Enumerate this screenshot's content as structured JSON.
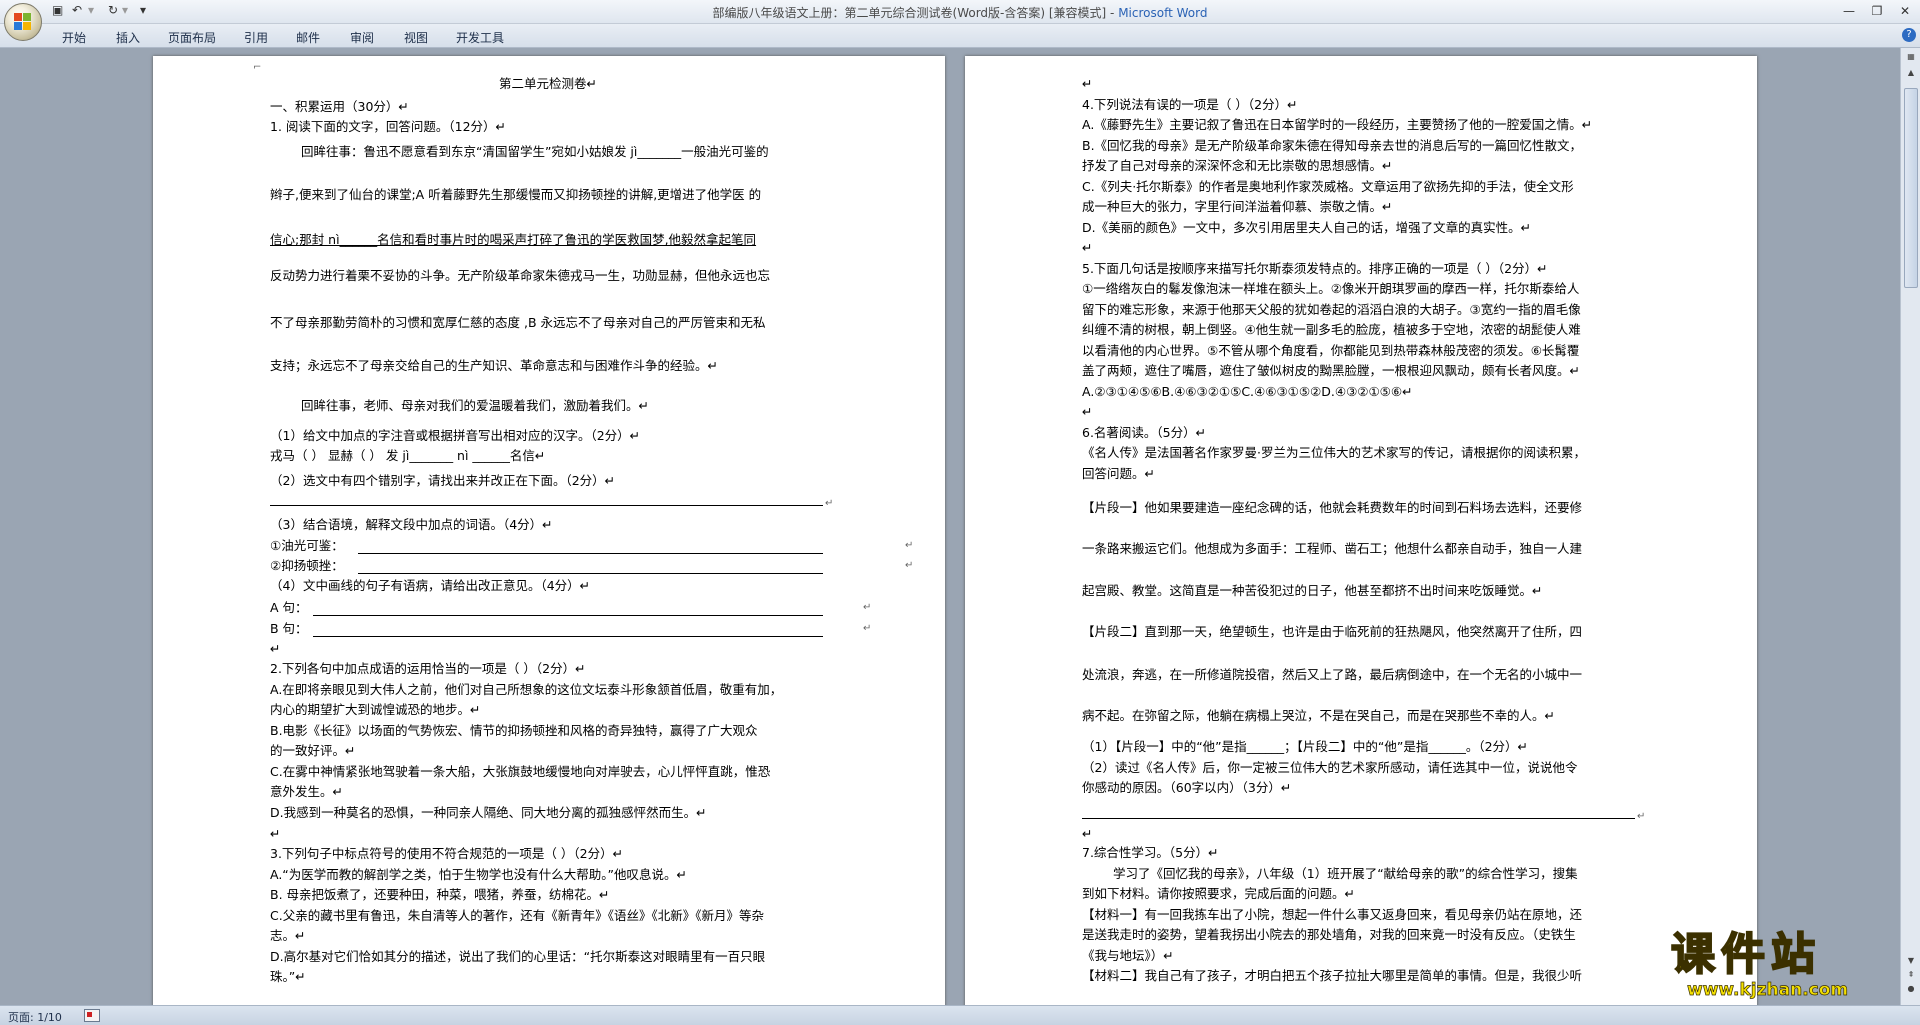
{
  "window": {
    "title": "部编版八年级语文上册：第二单元综合测试卷(Word版-含答案) [兼容模式] - ",
    "app_name": "Microsoft Word",
    "controls": [
      "—",
      "❐",
      "✕"
    ]
  },
  "qat": {
    "save_icon": "save-icon",
    "undo": "↶",
    "redo": "↻",
    "more": "▾"
  },
  "ribbon": {
    "tabs": [
      "开始",
      "插入",
      "页面布局",
      "引用",
      "邮件",
      "审阅",
      "视图",
      "开发工具"
    ],
    "help": "?"
  },
  "status": {
    "page_indicator": "页面: 1/10"
  },
  "page1": [
    {
      "t": "第二单元检测卷↵"
    },
    {
      "t": "一、积累运用（30分）↵"
    },
    {
      "t": "1. 阅读下面的文字，回答问题。（12分）↵"
    },
    {
      "t": "回眸往事：鲁迅不愿意看到东京“清国留学生”宛如小姑娘发 jì_______一般油光可鉴的"
    },
    {
      "t": "辫子,便来到了仙台的课堂;A 听着藤野先生那缓慢而又抑扬顿挫的讲解,更增进了他学医 的"
    },
    {
      "t": "信心;那封 nì______名信和看时事片时的喝采声打碎了鲁迅的学医救国梦,他毅然拿起笔同"
    },
    {
      "t": "反动势力进行着栗不妥协的斗争。无产阶级革命家朱德戎马一生，功勋显赫，但他永远也忘"
    },
    {
      "t": "不了母亲那勤劳简朴的习惯和宽厚仁慈的态度 ,B 永远忘不了母亲对自己的严厉管束和无私"
    },
    {
      "t": "支持；永远忘不了母亲交给自己的生产知识、革命意志和与困难作斗争的经验。↵"
    },
    {
      "t": "回眸往事，老师、母亲对我们的爱温暖着我们，激励着我们。↵"
    },
    {
      "t": "（1）给文中加点的字注音或根据拼音写出相对应的汉字。（2分）↵"
    },
    {
      "t": "戎马（     ）    显赫（     ）    发 jì_______     nì ______名信↵"
    },
    {
      "t": "（2）选文中有四个错别字，请找出来并改正在下面。（2分）↵"
    },
    {
      "t": "（3）结合语境，解释文段中加点的词语。（4分）↵"
    },
    {
      "t": "①油光可鉴："
    },
    {
      "t": "②抑扬顿挫："
    },
    {
      "t": "（4）文中画线的句子有语病，请给出改正意见。（4分）↵"
    },
    {
      "t": "A 句："
    },
    {
      "t": "B 句："
    },
    {
      "t": "↵"
    },
    {
      "t": "2.下列各句中加点成语的运用恰当的一项是（    ）（2分）↵"
    },
    {
      "t": "A.在即将亲眼见到大伟人之前，他们对自己所想象的这位文坛泰斗形象颔首低眉，敬重有加，"
    },
    {
      "t": "内心的期望扩大到诚惶诚恐的地步。↵"
    },
    {
      "t": "B.电影《长征》以场面的气势恢宏、情节的抑扬顿挫和风格的奇异独特，赢得了广大观众"
    },
    {
      "t": "的一致好评。↵"
    },
    {
      "t": "C.在雾中神情紧张地驾驶着一条大船，大张旗鼓地缓慢地向对岸驶去，心儿怦怦直跳，惟恐"
    },
    {
      "t": "意外发生。↵"
    },
    {
      "t": "D.我感到一种莫名的恐惧，一种同亲人隔绝、同大地分离的孤独感怦然而生。↵"
    },
    {
      "t": "↵"
    },
    {
      "t": "3.下列句子中标点符号的使用不符合规范的一项是（    ）（2分）↵"
    },
    {
      "t": "A.“为医学而教的解剖学之类，怕于生物学也没有什么大帮助。”他叹息说。↵"
    },
    {
      "t": "B. 母亲把饭煮了，还要种田，种菜，喂猪，养蚕，纺棉花。↵"
    },
    {
      "t": "C.父亲的藏书里有鲁迅，朱自清等人的著作，还有《新青年》《语丝》《北新》《新月》等杂"
    },
    {
      "t": "志。↵"
    },
    {
      "t": "D.高尔基对它们恰如其分的描述，说出了我们的心里话：“托尔斯泰这对眼睛里有一百只眼"
    },
    {
      "t": "珠。”↵"
    }
  ],
  "page2": [
    {
      "t": "↵"
    },
    {
      "t": "4.下列说法有误的一项是（     ）（2分）↵"
    },
    {
      "t": "A.《藤野先生》主要记叙了鲁迅在日本留学时的一段经历，主要赞扬了他的一腔爱国之情。↵"
    },
    {
      "t": "B.《回忆我的母亲》是无产阶级革命家朱德在得知母亲去世的消息后写的一篇回忆性散文，"
    },
    {
      "t": "抒发了自己对母亲的深深怀念和无比崇敬的思想感情。↵"
    },
    {
      "t": "C.《列夫·托尔斯泰》的作者是奥地利作家茨威格。文章运用了欲扬先抑的手法，使全文形"
    },
    {
      "t": "成一种巨大的张力，字里行间洋溢着仰慕、崇敬之情。↵"
    },
    {
      "t": "D.《美丽的颜色》一文中，多次引用居里夫人自己的话，增强了文章的真实性。↵"
    },
    {
      "t": "↵"
    },
    {
      "t": "5.下面几句话是按顺序来描写托尔斯泰须发特点的。排序正确的一项是（     ）（2分）↵"
    },
    {
      "t": "①一绺绺灰白的鬈发像泡沫一样堆在额头上。②像米开朗琪罗画的摩西一样，托尔斯泰给人"
    },
    {
      "t": "留下的难忘形象，来源于他那天父般的犹如卷起的滔滔白浪的大胡子。③宽约一指的眉毛像"
    },
    {
      "t": "纠缠不清的树根，朝上倒竖。④他生就一副多毛的脸庞，植被多于空地，浓密的胡髭使人难"
    },
    {
      "t": "以看清他的内心世界。⑤不管从哪个角度看，你都能见到热带森林般茂密的须发。⑥长髯覆"
    },
    {
      "t": "盖了两颊，遮住了嘴唇，遮住了皱似树皮的黝黑脸膛，一根根迎风飘动，颇有长者风度。↵"
    },
    {
      "t": "A.②③①④⑤⑥B.④⑥③②①⑤C.④⑥③①⑤②D.④③②①⑤⑥↵"
    },
    {
      "t": "↵"
    },
    {
      "t": "6.名著阅读。（5分）↵"
    },
    {
      "t": "《名人传》是法国著名作家罗曼·罗兰为三位伟大的艺术家写的传记，请根据你的阅读积累，"
    },
    {
      "t": "回答问题。↵"
    },
    {
      "t": "【片段一】他如果要建造一座纪念碑的话，他就会耗费数年的时间到石料场去选料，还要修"
    },
    {
      "t": "一条路来搬运它们。他想成为多面手：工程师、凿石工；他想什么都亲自动手，独自一人建"
    },
    {
      "t": "起宫殿、教堂。这简直是一种苦役犯过的日子，他甚至都挤不出时间来吃饭睡觉。↵"
    },
    {
      "t": "【片段二】直到那一天，绝望顿生，也许是由于临死前的狂热飓风，他突然离开了住所，四"
    },
    {
      "t": "处流浪，奔逃，在一所修道院投宿，然后又上了路，最后病倒途中，在一个无名的小城中一"
    },
    {
      "t": "病不起。在弥留之际，他躺在病榻上哭泣，不是在哭自己，而是在哭那些不幸的人。↵"
    },
    {
      "t": "（1）【片段一】中的“他”是指______；【片段二】中的“他”是指______。（2分）↵"
    },
    {
      "t": "（2）读过《名人传》后，你一定被三位伟大的艺术家所感动，请任选其中一位，说说他令"
    },
    {
      "t": "你感动的原因。（60字以内）（3分）↵"
    },
    {
      "t": "↵"
    },
    {
      "t": "7.综合性学习。（5分）↵"
    },
    {
      "t": "学习了《回忆我的母亲》，八年级（1）班开展了“献给母亲的歌”的综合性学习，搜集"
    },
    {
      "t": "到如下材料。请你按照要求，完成后面的问题。↵"
    },
    {
      "t": "【材料一】有一回我拣车出了小院，想起一件什么事又返身回来，看见母亲仍站在原地，还"
    },
    {
      "t": "是送我走时的姿势，望着我拐出小院去的那处墙角，对我的回来竟一时没有反应。（史铁生"
    },
    {
      "t": "《我与地坛》）↵"
    },
    {
      "t": "【材料二】我自己有了孩子，才明白把五个孩子拉扯大哪里是简单的事情。但是，我很少听"
    }
  ],
  "watermark": {
    "big": "课件站",
    "url": "www.kjzhan.com"
  },
  "colors": {
    "app_name": "#2a62b5",
    "page_bg": "#ffffff",
    "workspace": "#9aa5b3",
    "watermark": "#f4e000"
  }
}
